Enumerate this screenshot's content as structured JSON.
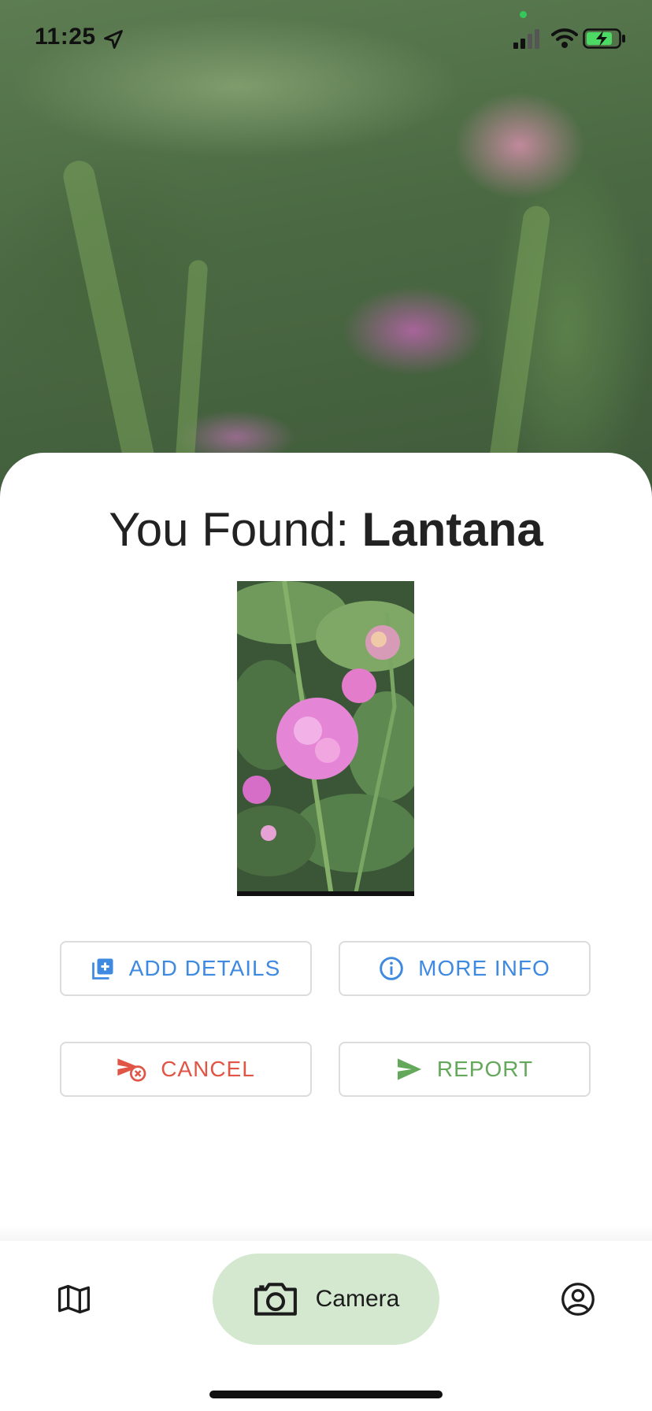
{
  "status_bar": {
    "time": "11:25"
  },
  "result": {
    "prefix": "You Found: ",
    "plant_name": "Lantana"
  },
  "actions": {
    "add_details": "ADD DETAILS",
    "more_info": "MORE INFO",
    "cancel": "CANCEL",
    "report": "REPORT"
  },
  "bottom_nav": {
    "items": [
      {
        "icon": "map-icon",
        "label": ""
      },
      {
        "icon": "camera-icon",
        "label": "Camera",
        "selected": true
      },
      {
        "icon": "account-circle-icon",
        "label": ""
      }
    ]
  },
  "colors": {
    "primary_blue": "#3f8ae0",
    "cancel_red": "#e05545",
    "report_green": "#63a85b",
    "nav_selected_bg": "#d3e8cf"
  }
}
